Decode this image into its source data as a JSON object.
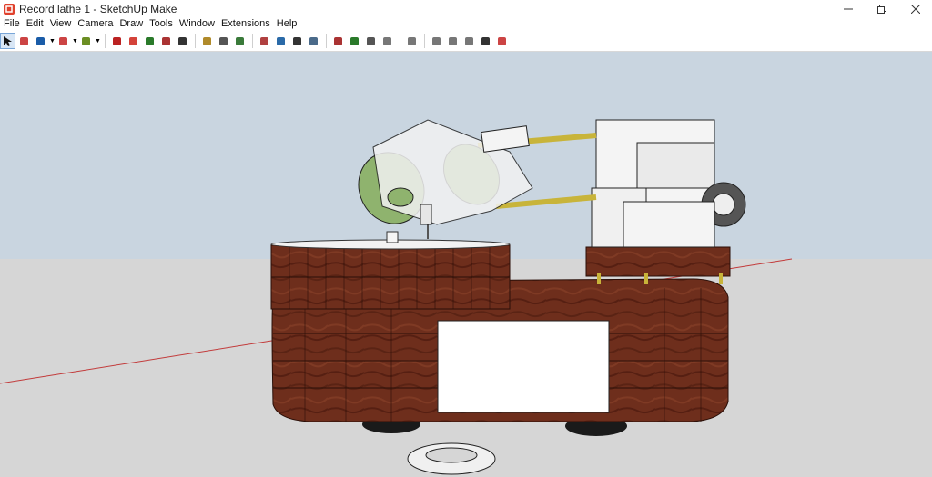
{
  "window": {
    "title": "Record lathe 1 - SketchUp Make",
    "controls": [
      "minimize",
      "restore",
      "close"
    ]
  },
  "menu": [
    "File",
    "Edit",
    "View",
    "Camera",
    "Draw",
    "Tools",
    "Window",
    "Extensions",
    "Help"
  ],
  "toolbar": [
    {
      "icon": "select-arrow-icon",
      "active": true
    },
    {
      "icon": "eraser-icon"
    },
    {
      "icon": "pencil-line-icon",
      "dropdown": true
    },
    {
      "icon": "arc-icon",
      "dropdown": true
    },
    {
      "icon": "shapes-icon",
      "dropdown": true
    },
    {
      "sep": true
    },
    {
      "icon": "push-pull-icon"
    },
    {
      "icon": "offset-icon"
    },
    {
      "icon": "move-icon"
    },
    {
      "icon": "rotate-icon"
    },
    {
      "icon": "scale-icon"
    },
    {
      "sep": true
    },
    {
      "icon": "tape-measure-icon"
    },
    {
      "icon": "text-icon"
    },
    {
      "icon": "paint-bucket-icon"
    },
    {
      "sep": true
    },
    {
      "icon": "orbit-icon"
    },
    {
      "icon": "pan-icon"
    },
    {
      "icon": "zoom-icon"
    },
    {
      "icon": "zoom-extents-icon"
    },
    {
      "sep": true
    },
    {
      "icon": "warehouse-icon"
    },
    {
      "icon": "share-model-icon"
    },
    {
      "icon": "extension-warehouse-icon"
    },
    {
      "icon": "share-component-icon"
    },
    {
      "sep": true
    },
    {
      "icon": "layers-icon"
    },
    {
      "sep": true
    },
    {
      "icon": "scene-1-icon"
    },
    {
      "icon": "scene-2-icon"
    },
    {
      "icon": "scene-3-icon"
    },
    {
      "icon": "scene-4-icon"
    },
    {
      "icon": "scene-5-icon"
    }
  ],
  "colors": {
    "wood": "#6e2e1c",
    "wood_dark": "#4e1c10",
    "ground": "#d6d6d6",
    "sky": "#c8d4df",
    "green_part": "#8fb36e",
    "brass_rod": "#c8b43a",
    "axis_red": "#c23b3b",
    "active_tool": "#d8e6f5"
  }
}
